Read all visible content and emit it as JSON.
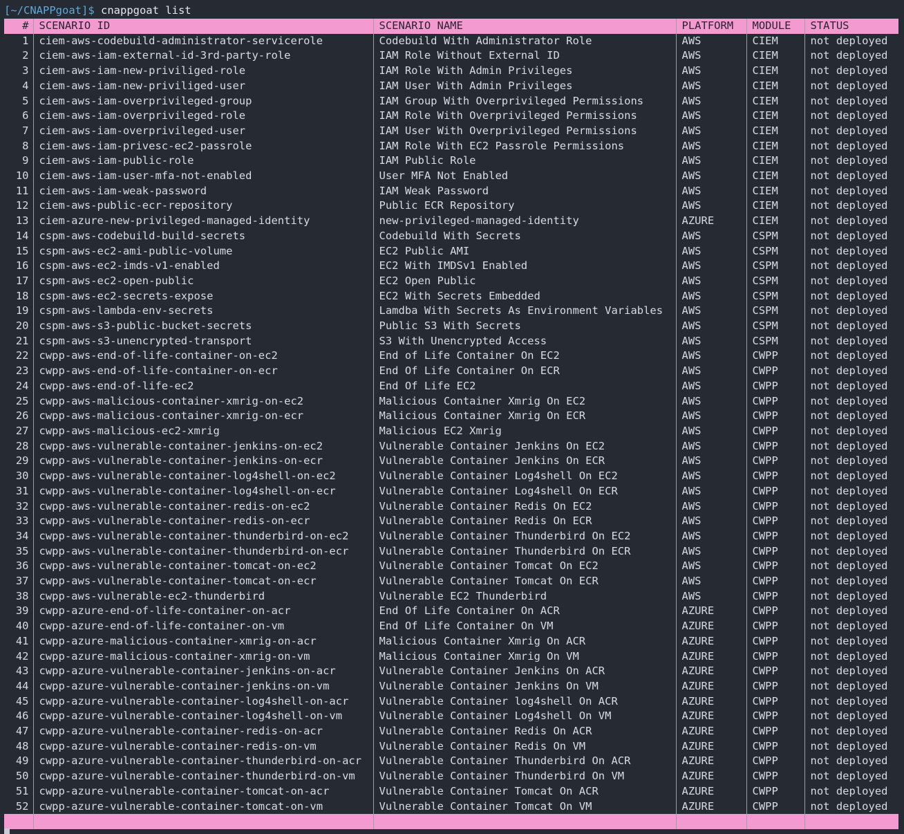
{
  "terminal": {
    "prompt_path": "[~/CNAPPgoat]$",
    "command": " cnappgoat list"
  },
  "table": {
    "headers": [
      "#",
      "SCENARIO ID",
      "SCENARIO NAME",
      "PLATFORM",
      "MODULE",
      "STATUS"
    ],
    "rows": [
      [
        "1",
        "ciem-aws-codebuild-administrator-servicerole",
        "Codebuild With Administrator Role",
        "AWS",
        "CIEM",
        "not deployed"
      ],
      [
        "2",
        "ciem-aws-iam-external-id-3rd-party-role",
        "IAM Role Without External ID",
        "AWS",
        "CIEM",
        "not deployed"
      ],
      [
        "3",
        "ciem-aws-iam-new-priviliged-role",
        "IAM Role With Admin Privileges",
        "AWS",
        "CIEM",
        "not deployed"
      ],
      [
        "4",
        "ciem-aws-iam-new-priviliged-user",
        "IAM User With Admin Privileges",
        "AWS",
        "CIEM",
        "not deployed"
      ],
      [
        "5",
        "ciem-aws-iam-overprivileged-group",
        "IAM Group With Overprivileged Permissions",
        "AWS",
        "CIEM",
        "not deployed"
      ],
      [
        "6",
        "ciem-aws-iam-overprivileged-role",
        "IAM Role With Overprivileged Permissions",
        "AWS",
        "CIEM",
        "not deployed"
      ],
      [
        "7",
        "ciem-aws-iam-overprivileged-user",
        "IAM User With Overprivileged Permissions",
        "AWS",
        "CIEM",
        "not deployed"
      ],
      [
        "8",
        "ciem-aws-iam-privesc-ec2-passrole",
        "IAM Role With EC2 Passrole Permissions",
        "AWS",
        "CIEM",
        "not deployed"
      ],
      [
        "9",
        "ciem-aws-iam-public-role",
        "IAM Public Role",
        "AWS",
        "CIEM",
        "not deployed"
      ],
      [
        "10",
        "ciem-aws-iam-user-mfa-not-enabled",
        "User MFA Not Enabled",
        "AWS",
        "CIEM",
        "not deployed"
      ],
      [
        "11",
        "ciem-aws-iam-weak-password",
        "IAM Weak Password",
        "AWS",
        "CIEM",
        "not deployed"
      ],
      [
        "12",
        "ciem-aws-public-ecr-repository",
        "Public ECR Repository",
        "AWS",
        "CIEM",
        "not deployed"
      ],
      [
        "13",
        "ciem-azure-new-privileged-managed-identity",
        "new-privileged-managed-identity",
        "AZURE",
        "CIEM",
        "not deployed"
      ],
      [
        "14",
        "cspm-aws-codebuild-build-secrets",
        "Codebuild With Secrets",
        "AWS",
        "CSPM",
        "not deployed"
      ],
      [
        "15",
        "cspm-aws-ec2-ami-public-volume",
        "EC2 Public AMI",
        "AWS",
        "CSPM",
        "not deployed"
      ],
      [
        "16",
        "cspm-aws-ec2-imds-v1-enabled",
        "EC2 With IMDSv1 Enabled",
        "AWS",
        "CSPM",
        "not deployed"
      ],
      [
        "17",
        "cspm-aws-ec2-open-public",
        "EC2 Open Public",
        "AWS",
        "CSPM",
        "not deployed"
      ],
      [
        "18",
        "cspm-aws-ec2-secrets-expose",
        "EC2 With Secrets Embedded",
        "AWS",
        "CSPM",
        "not deployed"
      ],
      [
        "19",
        "cspm-aws-lambda-env-secrets",
        "Lamdba With Secrets As Environment Variables",
        "AWS",
        "CSPM",
        "not deployed"
      ],
      [
        "20",
        "cspm-aws-s3-public-bucket-secrets",
        "Public S3 With Secrets",
        "AWS",
        "CSPM",
        "not deployed"
      ],
      [
        "21",
        "cspm-aws-s3-unencrypted-transport",
        "S3 With Unencrypted Access",
        "AWS",
        "CSPM",
        "not deployed"
      ],
      [
        "22",
        "cwpp-aws-end-of-life-container-on-ec2",
        "End of Life Container On EC2",
        "AWS",
        "CWPP",
        "not deployed"
      ],
      [
        "23",
        "cwpp-aws-end-of-life-container-on-ecr",
        "End Of Life Container On ECR",
        "AWS",
        "CWPP",
        "not deployed"
      ],
      [
        "24",
        "cwpp-aws-end-of-life-ec2",
        "End Of Life EC2",
        "AWS",
        "CWPP",
        "not deployed"
      ],
      [
        "25",
        "cwpp-aws-malicious-container-xmrig-on-ec2",
        "Malicious Container Xmrig On EC2",
        "AWS",
        "CWPP",
        "not deployed"
      ],
      [
        "26",
        "cwpp-aws-malicious-container-xmrig-on-ecr",
        "Malicious Container Xmrig On ECR",
        "AWS",
        "CWPP",
        "not deployed"
      ],
      [
        "27",
        "cwpp-aws-malicious-ec2-xmrig",
        "Malicious EC2 Xmrig",
        "AWS",
        "CWPP",
        "not deployed"
      ],
      [
        "28",
        "cwpp-aws-vulnerable-container-jenkins-on-ec2",
        "Vulnerable Container Jenkins On EC2",
        "AWS",
        "CWPP",
        "not deployed"
      ],
      [
        "29",
        "cwpp-aws-vulnerable-container-jenkins-on-ecr",
        "Vulnerable Container Jenkins On ECR",
        "AWS",
        "CWPP",
        "not deployed"
      ],
      [
        "30",
        "cwpp-aws-vulnerable-container-log4shell-on-ec2",
        "Vulnerable Container Log4shell On EC2",
        "AWS",
        "CWPP",
        "not deployed"
      ],
      [
        "31",
        "cwpp-aws-vulnerable-container-log4shell-on-ecr",
        "Vulnerable Container Log4shell On ECR",
        "AWS",
        "CWPP",
        "not deployed"
      ],
      [
        "32",
        "cwpp-aws-vulnerable-container-redis-on-ec2",
        "Vulnerable Container Redis On EC2",
        "AWS",
        "CWPP",
        "not deployed"
      ],
      [
        "33",
        "cwpp-aws-vulnerable-container-redis-on-ecr",
        "Vulnerable Container Redis On ECR",
        "AWS",
        "CWPP",
        "not deployed"
      ],
      [
        "34",
        "cwpp-aws-vulnerable-container-thunderbird-on-ec2",
        "Vulnerable Container Thunderbird On EC2",
        "AWS",
        "CWPP",
        "not deployed"
      ],
      [
        "35",
        "cwpp-aws-vulnerable-container-thunderbird-on-ecr",
        "Vulnerable Container Thunderbird On ECR",
        "AWS",
        "CWPP",
        "not deployed"
      ],
      [
        "36",
        "cwpp-aws-vulnerable-container-tomcat-on-ec2",
        "Vulnerable Container Tomcat On EC2",
        "AWS",
        "CWPP",
        "not deployed"
      ],
      [
        "37",
        "cwpp-aws-vulnerable-container-tomcat-on-ecr",
        "Vulnerable Container Tomcat On ECR",
        "AWS",
        "CWPP",
        "not deployed"
      ],
      [
        "38",
        "cwpp-aws-vulnerable-ec2-thunderbird",
        "Vulnerable EC2 Thunderbird",
        "AWS",
        "CWPP",
        "not deployed"
      ],
      [
        "39",
        "cwpp-azure-end-of-life-container-on-acr",
        "End Of Life Container On ACR",
        "AZURE",
        "CWPP",
        "not deployed"
      ],
      [
        "40",
        "cwpp-azure-end-of-life-container-on-vm",
        "End Of Life Container On VM",
        "AZURE",
        "CWPP",
        "not deployed"
      ],
      [
        "41",
        "cwpp-azure-malicious-container-xmrig-on-acr",
        "Malicious Container Xmrig On ACR",
        "AZURE",
        "CWPP",
        "not deployed"
      ],
      [
        "42",
        "cwpp-azure-malicious-container-xmrig-on-vm",
        "Malicious Container Xmrig On VM",
        "AZURE",
        "CWPP",
        "not deployed"
      ],
      [
        "43",
        "cwpp-azure-vulnerable-container-jenkins-on-acr",
        "Vulnerable Container Jenkins On ACR",
        "AZURE",
        "CWPP",
        "not deployed"
      ],
      [
        "44",
        "cwpp-azure-vulnerable-container-jenkins-on-vm",
        "Vulnerable Container Jenkins On VM",
        "AZURE",
        "CWPP",
        "not deployed"
      ],
      [
        "45",
        "cwpp-azure-vulnerable-container-log4shell-on-acr",
        "Vulnerable Container log4shell On ACR",
        "AZURE",
        "CWPP",
        "not deployed"
      ],
      [
        "46",
        "cwpp-azure-vulnerable-container-log4shell-on-vm",
        "Vulnerable Container Log4shell On VM",
        "AZURE",
        "CWPP",
        "not deployed"
      ],
      [
        "47",
        "cwpp-azure-vulnerable-container-redis-on-acr",
        "Vulnerable Container Redis On ACR",
        "AZURE",
        "CWPP",
        "not deployed"
      ],
      [
        "48",
        "cwpp-azure-vulnerable-container-redis-on-vm",
        "Vulnerable Container Redis On VM",
        "AZURE",
        "CWPP",
        "not deployed"
      ],
      [
        "49",
        "cwpp-azure-vulnerable-container-thunderbird-on-acr",
        "Vulnerable Container Thunderbird On ACR",
        "AZURE",
        "CWPP",
        "not deployed"
      ],
      [
        "50",
        "cwpp-azure-vulnerable-container-thunderbird-on-vm",
        "Vulnerable Container Thunderbird On VM",
        "AZURE",
        "CWPP",
        "not deployed"
      ],
      [
        "51",
        "cwpp-azure-vulnerable-container-tomcat-on-acr",
        "Vulnerable Container Tomcat On ACR",
        "AZURE",
        "CWPP",
        "not deployed"
      ],
      [
        "52",
        "cwpp-azure-vulnerable-container-tomcat-on-vm",
        "Vulnerable Container Tomcat On VM",
        "AZURE",
        "CWPP",
        "not deployed"
      ]
    ]
  },
  "colors": {
    "background": "#262a33",
    "header_footer_band": "#f39bd0",
    "prompt_path": "#5fa8d8",
    "text": "#d8dbe2"
  }
}
